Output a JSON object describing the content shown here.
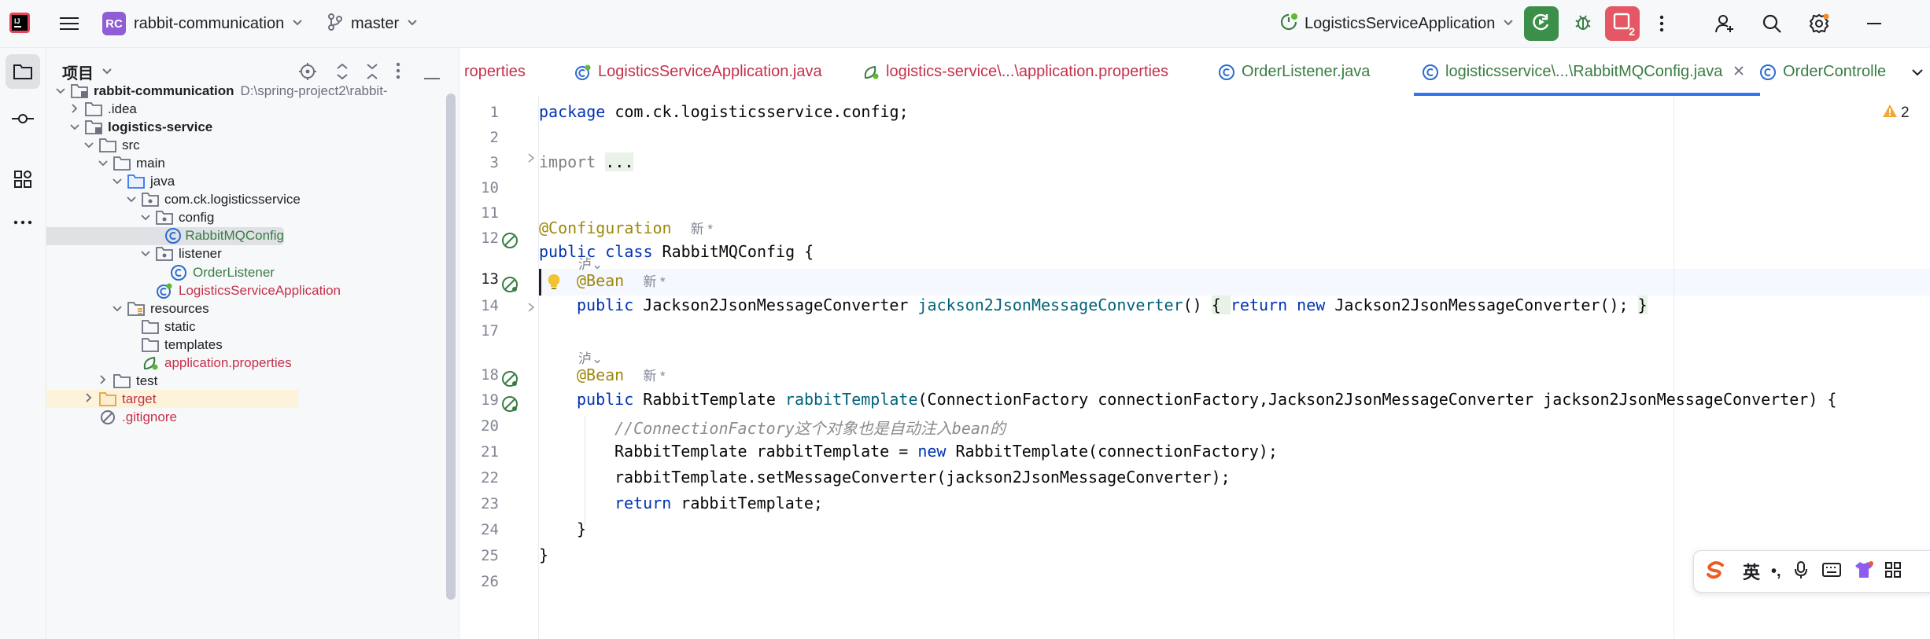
{
  "titlebar": {
    "project_badge": "RC",
    "project_name": "rabbit-communication",
    "branch": "master",
    "run_config": "LogisticsServiceApplication",
    "running_count": "2"
  },
  "project_panel": {
    "title": "项目",
    "tree": [
      {
        "label": "rabbit-communication",
        "path_hint": "D:\\spring-project2\\rabbit-",
        "level": 0,
        "arrow": "down",
        "icon": "module-folder-icon",
        "style": "bold"
      },
      {
        "label": ".idea",
        "level": 1,
        "arrow": "right",
        "icon": "folder-icon",
        "style": "normal"
      },
      {
        "label": "logistics-service",
        "level": 1,
        "arrow": "down",
        "icon": "module-folder-icon",
        "style": "bold"
      },
      {
        "label": "src",
        "level": 2,
        "arrow": "down",
        "icon": "folder-icon",
        "style": "normal"
      },
      {
        "label": "main",
        "level": 3,
        "arrow": "down",
        "icon": "folder-icon",
        "style": "normal"
      },
      {
        "label": "java",
        "level": 4,
        "arrow": "down",
        "icon": "source-folder-icon",
        "style": "normal"
      },
      {
        "label": "com.ck.logisticsservice",
        "level": 5,
        "arrow": "down",
        "icon": "package-icon",
        "style": "normal"
      },
      {
        "label": "config",
        "level": 6,
        "arrow": "down",
        "icon": "package-icon",
        "style": "normal"
      },
      {
        "label": "RabbitMQConfig",
        "level": 7,
        "arrow": "",
        "icon": "class-icon",
        "style": "green",
        "selected": true
      },
      {
        "label": "listener",
        "level": 6,
        "arrow": "down",
        "icon": "package-icon",
        "style": "normal"
      },
      {
        "label": "OrderListener",
        "level": 7,
        "arrow": "",
        "icon": "class-icon",
        "style": "green"
      },
      {
        "label": "LogisticsServiceApplication",
        "level": 6,
        "arrow": "",
        "icon": "spring-class-icon",
        "style": "red"
      },
      {
        "label": "resources",
        "level": 4,
        "arrow": "down",
        "icon": "resources-folder-icon",
        "style": "normal"
      },
      {
        "label": "static",
        "level": 5,
        "arrow": "",
        "icon": "folder-icon",
        "style": "normal"
      },
      {
        "label": "templates",
        "level": 5,
        "arrow": "",
        "icon": "folder-icon",
        "style": "normal"
      },
      {
        "label": "application.properties",
        "level": 5,
        "arrow": "",
        "icon": "spring-properties-icon",
        "style": "red"
      },
      {
        "label": "test",
        "level": 3,
        "arrow": "right",
        "icon": "folder-icon",
        "style": "normal"
      },
      {
        "label": "target",
        "level": 2,
        "arrow": "right",
        "icon": "excluded-folder-icon",
        "style": "red",
        "highlight": true
      },
      {
        "label": ".gitignore",
        "level": 2,
        "arrow": "",
        "icon": "ignore-file-icon",
        "style": "red"
      }
    ]
  },
  "tabs": [
    {
      "label": "roperties",
      "style": "red",
      "icon": ""
    },
    {
      "label": "LogisticsServiceApplication.java",
      "style": "red",
      "icon": "spring-class-icon"
    },
    {
      "label": "logistics-service\\...\\application.properties",
      "style": "red",
      "icon": "spring-properties-icon"
    },
    {
      "label": "OrderListener.java",
      "style": "green",
      "icon": "class-icon"
    },
    {
      "label": "logisticsservice\\...\\RabbitMQConfig.java",
      "style": "green",
      "icon": "class-icon",
      "active": true
    },
    {
      "label": "OrderControlle",
      "style": "green",
      "icon": "class-icon"
    }
  ],
  "editor": {
    "warnings_count": "2",
    "author_hint": "泸",
    "new_hint": "新 *",
    "line_numbers": [
      "1",
      "2",
      "3",
      "10",
      "11",
      "12",
      "13",
      "14",
      "17",
      "18",
      "19",
      "20",
      "21",
      "22",
      "23",
      "24",
      "25",
      "26"
    ],
    "code": {
      "l1_kw": "package",
      "l1_rest": " com.ck.logisticsservice.config;",
      "l3_kw": "import",
      "l3_fold": "...",
      "l11_ann": "@Configuration",
      "l12_kw": "public class",
      "l12_rest": " RabbitMQConfig {",
      "l13_ann": "@Bean",
      "l14_kw": "public",
      "l14_type": " Jackson2JsonMessageConverter ",
      "l14_fn": "jackson2JsonMessageConverter",
      "l14_paren": "() ",
      "l14_fold_open": "{ ",
      "l14_kw2": "return new",
      "l14_rest": " Jackson2JsonMessageConverter(); ",
      "l14_fold_close": "}",
      "l18_ann": "@Bean",
      "l19_kw": "public",
      "l19_type": " RabbitTemplate ",
      "l19_fn": "rabbitTemplate",
      "l19_rest": "(ConnectionFactory connectionFactory,Jackson2JsonMessageConverter jackson2JsonMessageConverter) {",
      "l20_comment": "//ConnectionFactory这个对象也是自动注入bean的",
      "l21_pre": "RabbitTemplate rabbitTemplate = ",
      "l21_kw": "new",
      "l21_rest": " RabbitTemplate(connectionFactory);",
      "l22": "rabbitTemplate.setMessageConverter(jackson2JsonMessageConverter);",
      "l23_kw": "return",
      "l23_rest": " rabbitTemplate;",
      "l24": "}",
      "l25": "}"
    }
  },
  "ime": {
    "lang": "英",
    "punct": "•,"
  }
}
